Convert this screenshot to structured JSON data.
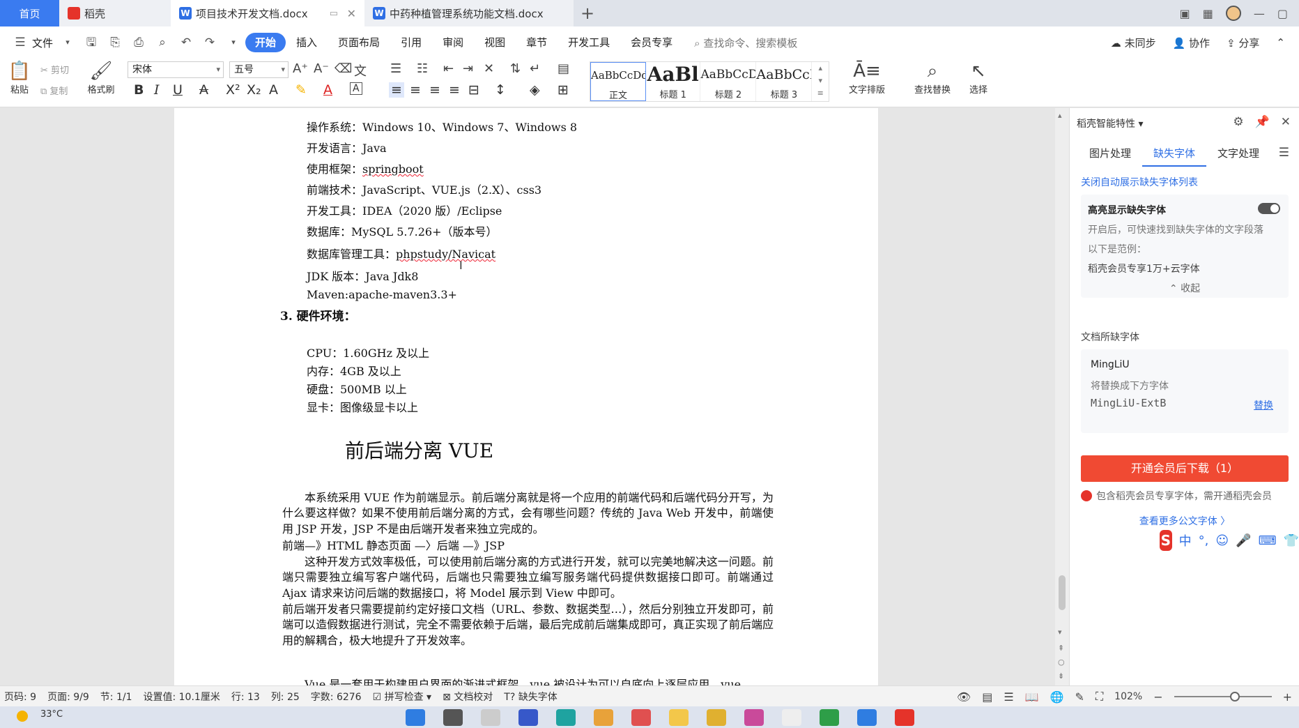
{
  "tabs": {
    "home": "首页",
    "daoke": "稻壳",
    "doc1": "项目技术开发文档.docx",
    "doc2": "中药种植管理系统功能文档.docx",
    "add": "+"
  },
  "menu": {
    "file": "文件",
    "items": [
      "开始",
      "插入",
      "页面布局",
      "引用",
      "审阅",
      "视图",
      "章节",
      "开发工具",
      "会员专享"
    ],
    "search": "查找命令、搜索模板",
    "unsynced": "未同步",
    "collab": "协作",
    "share": "分享"
  },
  "ribbon": {
    "paste": "粘贴",
    "cut": "剪切",
    "copy": "复制",
    "format_painter": "格式刷",
    "font_name": "宋体",
    "font_size": "五号",
    "styles": [
      {
        "preview": "AaBbCcDd",
        "name": "正文"
      },
      {
        "preview": "AaBl",
        "name": "标题 1"
      },
      {
        "preview": "AaBbCcD",
        "name": "标题 2"
      },
      {
        "preview": "AaBbCcI",
        "name": "标题 3"
      }
    ],
    "text_layout": "文字排版",
    "find_replace": "查找替换",
    "select": "选择"
  },
  "document": {
    "env_lines": [
      "操作系统：Windows 10、Windows 7、Windows 8",
      "开发语言：Java",
      "使用框架：springboot",
      "前端技术：JavaScript、VUE.js（2.X）、css3",
      "开发工具：IDEA（2020 版）/Eclipse",
      "数据库：MySQL 5.7.26+（版本号）",
      "数据库管理工具：phpstudy/Navicat",
      "JDK 版本：Java Jdk8",
      "Maven:apache-maven3.3+"
    ],
    "hw_heading": "3. 硬件环境：",
    "hw_lines": [
      "CPU：1.60GHz 及以上",
      "内存：4GB 及以上",
      "硬盘：500MB 以上",
      "显卡：图像级显卡以上"
    ],
    "section_title": "前后端分离 VUE",
    "paragraphs": [
      "　　本系统采用 VUE 作为前端显示。前后端分离就是将一个应用的前端代码和后端代码分开写，为什么要这样做？如果不使用前后端分离的方式，会有哪些问题？传统的 Java Web 开发中，前端使用 JSP 开发，JSP 不是由后端开发者来独立完成的。",
      "前端—》HTML 静态页面 —〉后端 —》JSP",
      "　　这种开发方式效率极低，可以使用前后端分离的方式进行开发，就可以完美地解决这一问题。前端只需要独立编写客户端代码，后端也只需要独立编写服务端代码提供数据接口即可。前端通过 Ajax 请求来访问后端的数据接口，将 Model 展示到 View 中即可。",
      "前后端开发者只需要提前约定好接口文档（URL、参数、数据类型…），然后分别独立开发即可，前端可以造假数据进行测试，完全不需要依赖于后端，最后完成前后端集成即可，真正实现了前后端应用的解耦合，极大地提升了开发效率。",
      "　　Vue 是一套用于构建用户界面的渐进式框架。vue 被设计为可以自底向上逐层应用。vue"
    ]
  },
  "panel": {
    "title": "稻壳智能特性",
    "tabs": [
      "图片处理",
      "缺失字体",
      "文字处理"
    ],
    "close_auto": "关闭自动展示缺失字体列表",
    "highlight_title": "高亮显示缺失字体",
    "highlight_desc": "开启后，可快速找到缺失字体的文字段落",
    "example_label": "以下是范例：",
    "example_text": "稻壳会员专享1万+云字体",
    "collapse": "收起",
    "missing_label": "文档所缺字体",
    "missing_font": "MingLiU",
    "replace_hint": "将替换成下方字体",
    "replacement_font": "MingLiU-ExtB",
    "replace_link": "替换",
    "download_btn": "开通会员后下载（1）",
    "member_note": "包含稻壳会员专享字体，需开通稻壳会员",
    "more_fonts": "查看更多公文字体 〉"
  },
  "ime": {
    "logo": "S",
    "lang": "中"
  },
  "status": {
    "page_code": "页码: 9",
    "page": "页面: 9/9",
    "section": "节: 1/1",
    "setting": "设置值: 10.1厘米",
    "row": "行: 13",
    "col": "列: 25",
    "words": "字数: 6276",
    "spell": "拼写检查",
    "proof": "文档校对",
    "missing_font": "缺失字体",
    "zoom": "102%"
  },
  "taskbar": {
    "temperature": "33°C"
  },
  "colors": {
    "accent": "#3a7bf0",
    "download": "#f04a33",
    "link": "#2f6fe4"
  }
}
